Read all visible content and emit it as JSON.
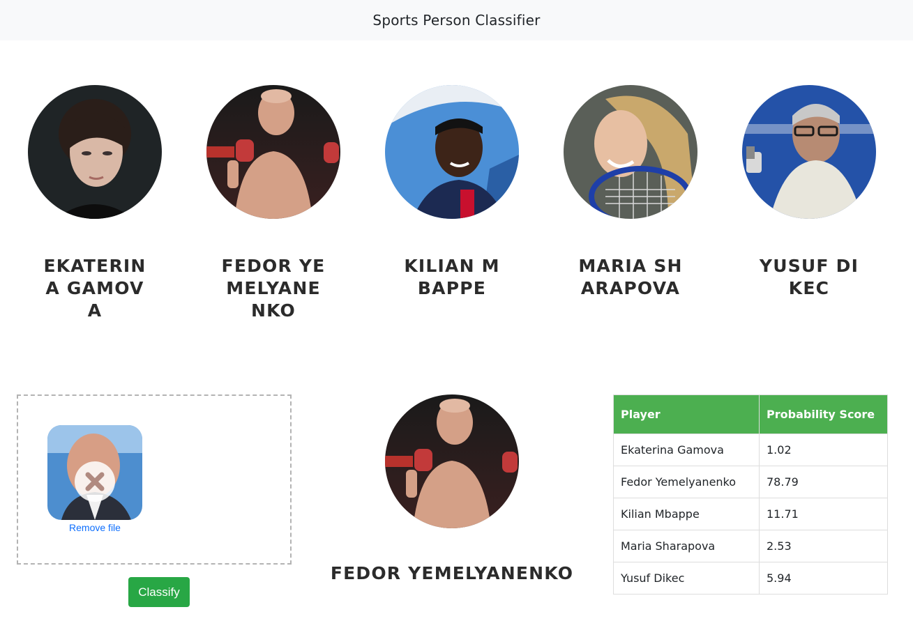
{
  "navbar": {
    "title": "Sports Person Classifier"
  },
  "players": [
    {
      "name": "EKATERINA GAMOVA"
    },
    {
      "name": "FEDOR YEMELYANENKO"
    },
    {
      "name": "KILIAN MBAPPE"
    },
    {
      "name": "MARIA SHARAPOVA"
    },
    {
      "name": "YUSUF DIKEC"
    }
  ],
  "upload": {
    "remove_label": "Remove file",
    "remove_icon": "close-icon"
  },
  "classify_button": {
    "label": "Classify",
    "color": "#28a745"
  },
  "result": {
    "name": "FEDOR YEMELYANENKO"
  },
  "table": {
    "header_color": "#4caf50",
    "headers": [
      "Player",
      "Probability Score"
    ],
    "rows": [
      {
        "player": "Ekaterina Gamova",
        "score": "1.02"
      },
      {
        "player": "Fedor Yemelyanenko",
        "score": "78.79"
      },
      {
        "player": "Kilian Mbappe",
        "score": "11.71"
      },
      {
        "player": "Maria Sharapova",
        "score": "2.53"
      },
      {
        "player": "Yusuf Dikec",
        "score": "5.94"
      }
    ]
  }
}
